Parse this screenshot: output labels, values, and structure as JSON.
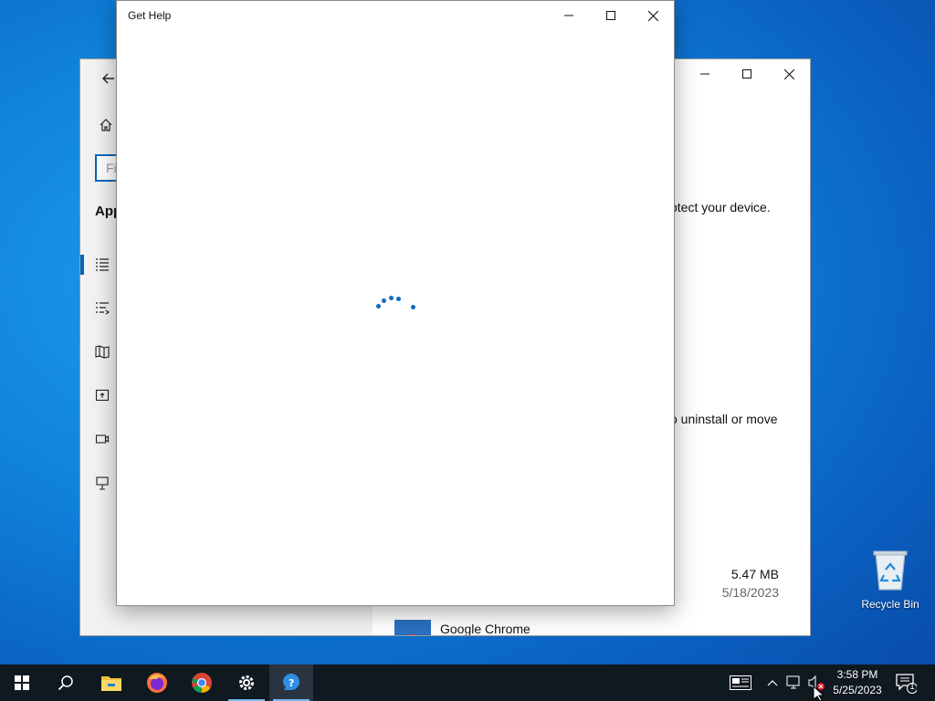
{
  "settings_window": {
    "search_placeholder": "Fi",
    "section_heading": "App",
    "text_protect": "otect your device.",
    "text_uninstall": "o uninstall or move",
    "app_item": {
      "size": "5.47 MB",
      "date": "5/18/2023",
      "name": "Google Chrome"
    }
  },
  "gethelp_window": {
    "title": "Get Help",
    "state": "loading"
  },
  "desktop": {
    "recycle_bin_label": "Recycle Bin"
  },
  "taskbar": {
    "apps": [
      "start-icon",
      "search-icon",
      "file-explorer-icon",
      "firefox-icon",
      "chrome-icon",
      "settings-icon",
      "get-help-icon"
    ],
    "clock_time": "3:58 PM",
    "clock_date": "5/25/2023",
    "notification_count": "1"
  },
  "colors": {
    "accent": "#0067c0",
    "taskbar": "#101820",
    "spinner": "#0f6cbd"
  }
}
